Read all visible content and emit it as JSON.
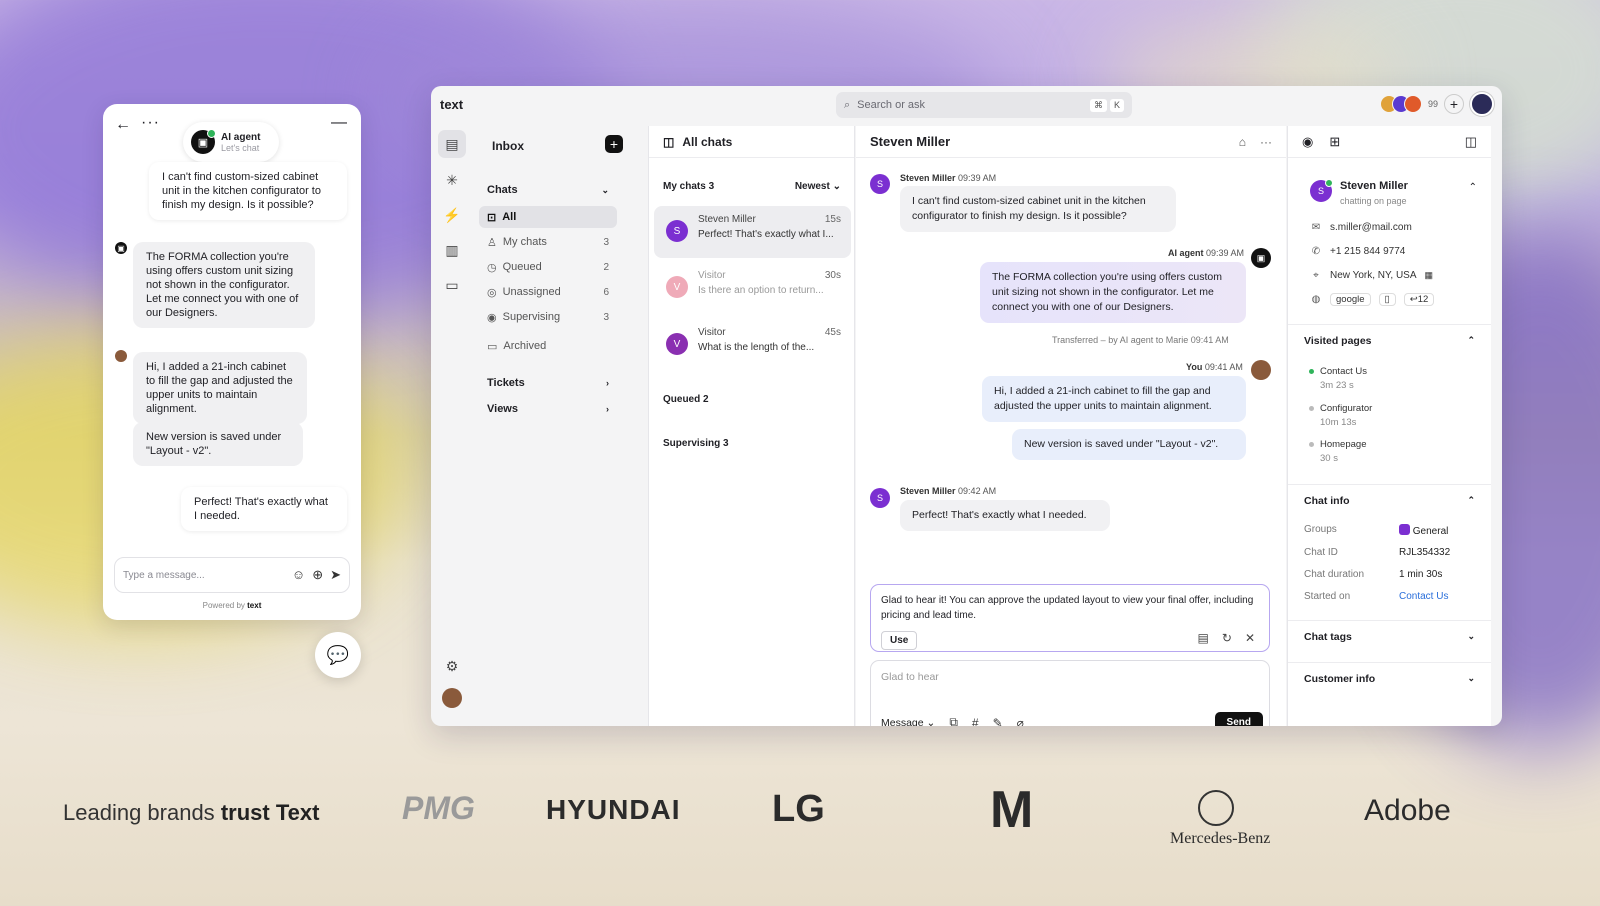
{
  "widget": {
    "agent_name": "AI agent",
    "agent_sub": "Let's chat",
    "messages": [
      "I can't find custom-sized cabinet unit in the kitchen configurator to finish my design. Is it possible?",
      "The FORMA collection you're using offers custom unit sizing not shown in the configurator. Let me connect you with one of our Designers.",
      "Hi, I added a 21-inch cabinet to fill the gap and adjusted the upper units to maintain alignment.",
      "New version is saved under \"Layout - v2\".",
      "Perfect! That's exactly what I needed."
    ],
    "input_placeholder": "Type a message...",
    "powered_by": "Powered by",
    "powered_brand": "text"
  },
  "app": {
    "brand": "text",
    "search_placeholder": "Search or ask",
    "kbd1": "⌘",
    "kbd2": "K",
    "avatar_count": "99",
    "nav": {
      "title": "Inbox",
      "chats_label": "Chats",
      "items": [
        {
          "label": "All",
          "count": ""
        },
        {
          "label": "My chats",
          "count": "3"
        },
        {
          "label": "Queued",
          "count": "2"
        },
        {
          "label": "Unassigned",
          "count": "6"
        },
        {
          "label": "Supervising",
          "count": "3"
        },
        {
          "label": "Archived",
          "count": ""
        }
      ],
      "tickets_label": "Tickets",
      "views_label": "Views"
    },
    "list": {
      "title": "All chats",
      "my_chats": "My chats 3",
      "sort": "Newest",
      "chats": [
        {
          "initial": "S",
          "name": "Steven Miller",
          "time": "15s",
          "preview": "Perfect! That's exactly what I..."
        },
        {
          "initial": "V",
          "name": "Visitor",
          "time": "30s",
          "preview": "Is there an option to return..."
        },
        {
          "initial": "V",
          "name": "Visitor",
          "time": "45s",
          "preview": "What is the length of the..."
        }
      ],
      "queued": "Queued 2",
      "supervising": "Supervising 3"
    },
    "conversation": {
      "title": "Steven Miller",
      "m1_author": "Steven Miller",
      "m1_time": "09:39 AM",
      "m1_text": "I can't find custom-sized cabinet unit in the kitchen configurator to finish my design. Is it possible?",
      "m2_author": "AI agent",
      "m2_time": "09:39 AM",
      "m2_text": "The FORMA collection you're using offers custom unit sizing not shown in the configurator. Let me connect you with one of our Designers.",
      "transfer_note": "Transferred – by AI agent to Marie 09:41 AM",
      "m3_author": "You",
      "m3_time": "09:41 AM",
      "m3_text": "Hi, I added a 21-inch cabinet to fill the gap and adjusted the upper units to maintain alignment.",
      "m4_text": "New version is saved under \"Layout - v2\".",
      "m5_author": "Steven Miller",
      "m5_time": "09:42 AM",
      "m5_text": "Perfect! That's exactly what I needed.",
      "suggestion": "Glad to hear it! You can approve the updated layout to view your final offer, including pricing and lead time.",
      "use_label": "Use",
      "reply_text": "Glad to hear",
      "message_mode": "Message",
      "send_label": "Send"
    },
    "sidebar": {
      "name": "Steven Miller",
      "status": "chatting on page",
      "email": "s.miller@mail.com",
      "phone": "+1 215 844 9774",
      "location": "New York, NY, USA",
      "source": "google",
      "visits": "12",
      "visited_title": "Visited pages",
      "pages": [
        {
          "name": "Contact Us",
          "dur": "3m 23 s"
        },
        {
          "name": "Configurator",
          "dur": "10m 13s"
        },
        {
          "name": "Homepage",
          "dur": "30 s"
        }
      ],
      "chat_info_title": "Chat info",
      "groups_label": "Groups",
      "groups_value": "General",
      "chat_id_label": "Chat ID",
      "chat_id_value": "RJL354332",
      "duration_label": "Chat duration",
      "duration_value": "1 min 30s",
      "started_label": "Started on",
      "started_value": "Contact Us",
      "tags_title": "Chat tags",
      "customer_title": "Customer info"
    }
  },
  "brands": {
    "title_prefix": "Leading brands",
    "title_bold": "trust Text",
    "logos": [
      "PMG",
      "HYUNDAI",
      "LG",
      "M",
      "Mercedes-Benz",
      "Adobe"
    ]
  },
  "colors": {
    "accent_purple": "#7b2fd1",
    "send_bg": "#111111",
    "link": "#2a6fdb"
  }
}
